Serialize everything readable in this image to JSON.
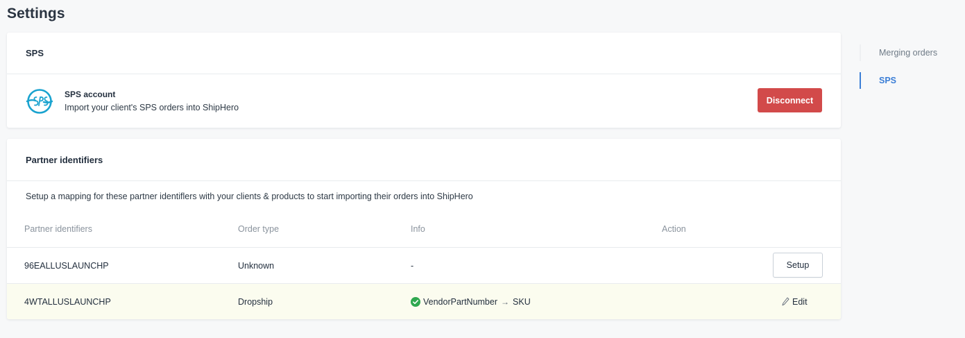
{
  "page": {
    "title": "Settings"
  },
  "sps_card": {
    "header": "SPS",
    "account_title": "SPS account",
    "account_desc": "Import your client's SPS orders into ShipHero",
    "disconnect_label": "Disconnect",
    "disconnect_color": "#d24a4a"
  },
  "partner_card": {
    "header": "Partner identifiers",
    "description": "Setup a mapping for these partner identiflers with your clients & products to start importing their orders into ShipHero",
    "columns": [
      "Partner identifiers",
      "Order type",
      "Info",
      "Action"
    ],
    "rows": [
      {
        "identifier": "96EALLUSLAUNCHP",
        "order_type": "Unknown",
        "info": "-",
        "action_label": "Setup"
      },
      {
        "identifier": "4WTALLUSLAUNCHP",
        "order_type": "Dropship",
        "info_from": "VendorPartNumber",
        "info_to": "SKU",
        "action_label": "Edit"
      }
    ]
  },
  "side_nav": {
    "items": [
      {
        "label": "Merging orders",
        "active": false
      },
      {
        "label": "SPS",
        "active": true
      }
    ],
    "active_color": "#3b7ed6"
  },
  "icons": {
    "sps_logo": "sps-logo",
    "check": "check-circle-icon",
    "arrow": "arrow-right-icon",
    "edit": "pencil-icon"
  }
}
